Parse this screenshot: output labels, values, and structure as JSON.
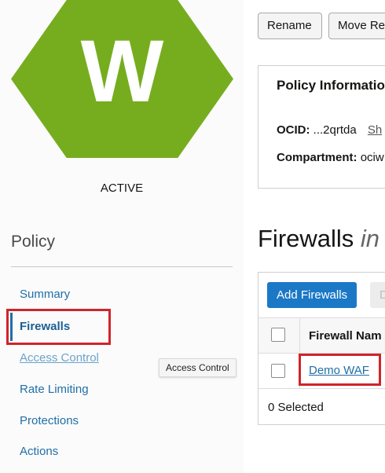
{
  "resource": {
    "icon_letter": "W",
    "status": "ACTIVE",
    "colors": {
      "hexagon": "#76ad1f",
      "highlight": "#d0242b",
      "link": "#1f6fa7",
      "primary_button": "#1b78c6"
    }
  },
  "actions": {
    "rename": "Rename",
    "move": "Move Re"
  },
  "policy_info": {
    "title": "Policy Informatio",
    "ocid_label": "OCID:",
    "ocid_value": "...2qrtda",
    "ocid_show": "Sh",
    "compartment_label": "Compartment:",
    "compartment_value": "ociw"
  },
  "sidebar": {
    "heading": "Policy",
    "items": [
      {
        "label": "Summary"
      },
      {
        "label": "Firewalls"
      },
      {
        "label": "Access Control"
      },
      {
        "label": "Rate Limiting"
      },
      {
        "label": "Protections"
      },
      {
        "label": "Actions"
      }
    ],
    "tooltip": "Access Control"
  },
  "firewalls": {
    "title": "Firewalls",
    "title_suffix": "in",
    "add_button": "Add Firewalls",
    "other_button": "D",
    "column_name": "Firewall Nam",
    "rows": [
      {
        "name": "Demo WAF"
      }
    ],
    "selected_status": "0 Selected"
  }
}
